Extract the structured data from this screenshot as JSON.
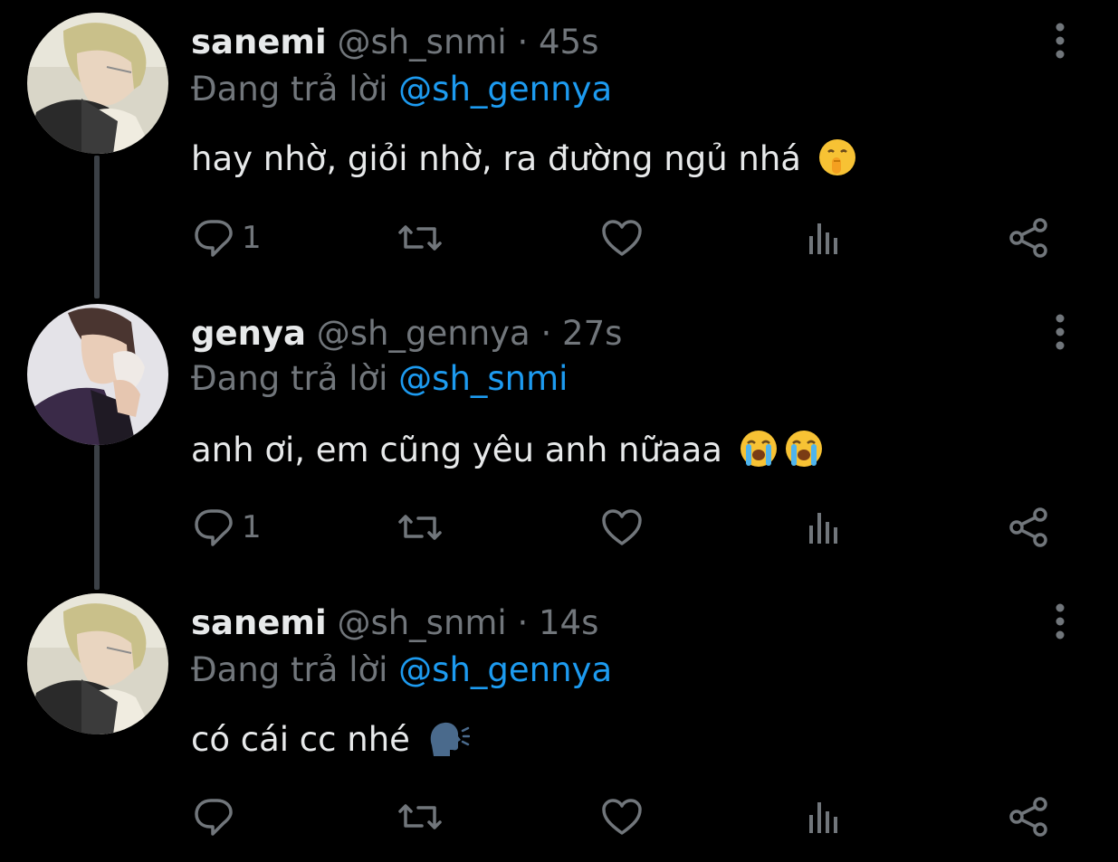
{
  "colors": {
    "background": "#000000",
    "text_primary": "#e7e9ea",
    "text_secondary": "#71767b",
    "mention": "#1d9bf0",
    "thread_line": "#3b4046"
  },
  "icons": {
    "reply": "speech-bubble-icon",
    "retweet": "retweet-arrows-icon",
    "like": "heart-icon",
    "views": "bar-chart-icon",
    "share": "share-nodes-icon",
    "more": "vertical-ellipsis-icon"
  },
  "tweets": [
    {
      "name": "sanemi",
      "handle": "@sh_snmi",
      "separator": "·",
      "time": "45s",
      "reply_prefix": "Đang trả lời",
      "reply_to": "@sh_gennya",
      "text": "hay nhờ, giỏi nhờ, ra đường ngủ nhá",
      "emoji": "shushing-face",
      "reply_count": "1"
    },
    {
      "name": "genya",
      "handle": "@sh_gennya",
      "separator": "·",
      "time": "27s",
      "reply_prefix": "Đang trả lời",
      "reply_to": "@sh_snmi",
      "text": "anh ơi, em cũng yêu anh nữaaa",
      "emoji": "loudly-crying-face x2",
      "reply_count": "1"
    },
    {
      "name": "sanemi",
      "handle": "@sh_snmi",
      "separator": "·",
      "time": "14s",
      "reply_prefix": "Đang trả lời",
      "reply_to": "@sh_gennya",
      "text": "có cái cc nhé",
      "emoji": "speaking-head",
      "reply_count": ""
    }
  ]
}
